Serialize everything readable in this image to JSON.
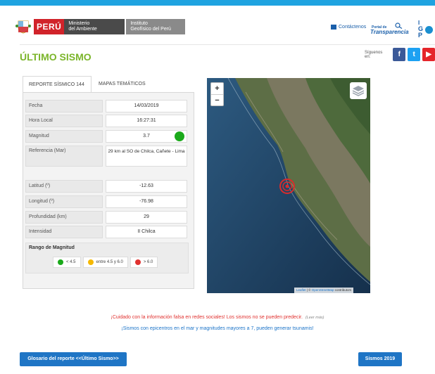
{
  "header": {
    "peru_label": "PERÚ",
    "ministry_line1": "Ministerio",
    "ministry_line2": "del Ambiente",
    "institute_line1": "Instituto",
    "institute_line2": "Geofísico del Perú",
    "contact_label": "Contáctenos",
    "transparency_top": "Portal de",
    "transparency_bottom": "Transparencia",
    "igp_l1": "I",
    "igp_l2": "G",
    "igp_l3": "P"
  },
  "page_title": "ÚLTIMO SISMO",
  "social": {
    "label": "Síguenos en:",
    "facebook": "f",
    "twitter": "t",
    "youtube": "▶"
  },
  "tabs": [
    {
      "label": "REPORTE SÍSMICO  144"
    },
    {
      "label": "MAPAS TEMÁTICOS"
    }
  ],
  "report": {
    "fecha": {
      "label": "Fecha",
      "value": "14/03/2019"
    },
    "hora": {
      "label": "Hora Local",
      "value": "16:27:31"
    },
    "magnitud": {
      "label": "Magnitud",
      "value": "3.7",
      "color": "#1aa91a"
    },
    "referencia": {
      "label": "Referencia (Mar)",
      "value": "29 km al SO de Chilca, Cañete - Lima"
    },
    "latitud": {
      "label": "Latitud (º)",
      "value": "-12.63"
    },
    "longitud": {
      "label": "Longitud (º)",
      "value": "-76.98"
    },
    "profundidad": {
      "label": "Profundidad (km)",
      "value": "29"
    },
    "intensidad": {
      "label": "Intensidad",
      "value": "II Chilca"
    }
  },
  "rango": {
    "title": "Rango de Magnitud",
    "items": [
      {
        "label": "< 4.5",
        "color": "#1aa91a"
      },
      {
        "label": "entre 4.5 y 6.0",
        "color": "#f5b800"
      },
      {
        "label": "> 6.0",
        "color": "#e0312f"
      }
    ]
  },
  "map": {
    "zoom_in": "+",
    "zoom_out": "−",
    "attribution_leaflet": "Leaflet",
    "attribution_sep": " | © ",
    "attribution_osm": "OpenStreetMap",
    "attribution_end": " contributors",
    "epicenter_color": "#d92b2b"
  },
  "notices": {
    "warning": "¡Cuidado con la información falsa en redes sociales! Los sismos no se pueden predecir.",
    "read_more": "(Leer más)",
    "tsunami": "¡Sismos con epicentros en el mar y magnitudes mayores a 7, pueden generar tsunamis!"
  },
  "buttons": {
    "glosario": "Glosario del reporte <<Último Sismo>>",
    "sismos": "Sismos 2019"
  }
}
